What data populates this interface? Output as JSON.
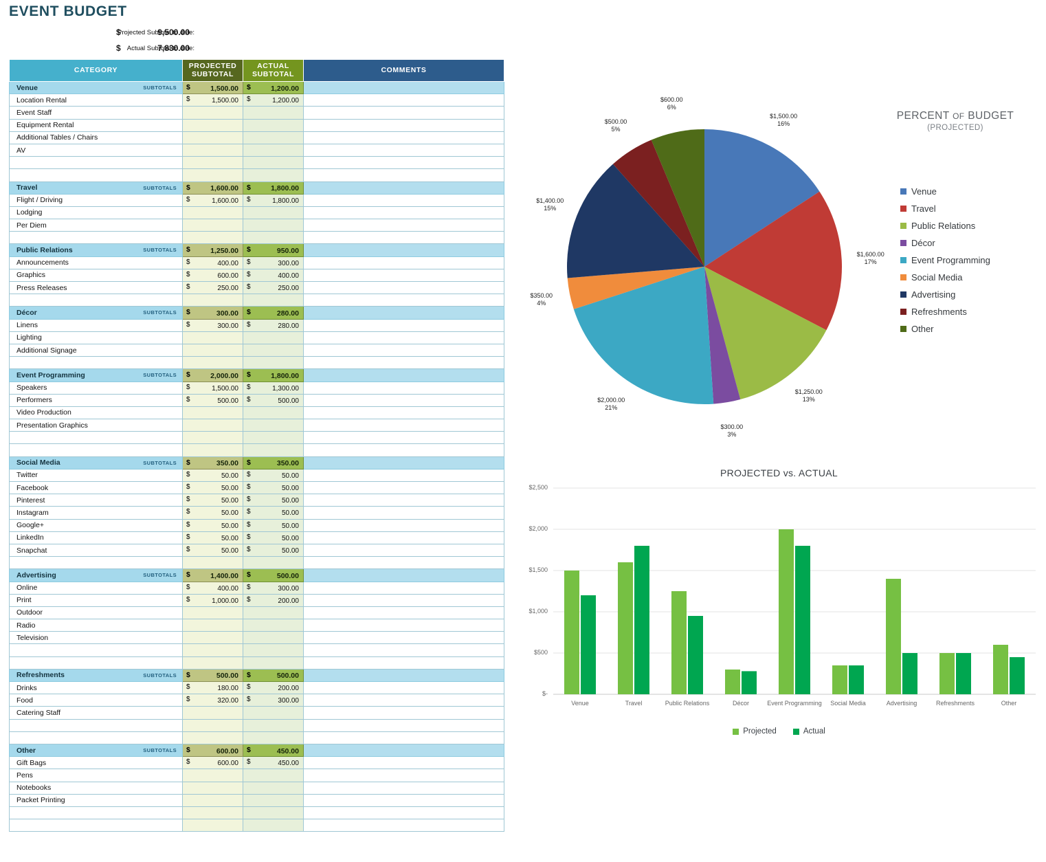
{
  "title": "EVENT BUDGET",
  "summary": {
    "projected_label": "Projected Subtotal to date:",
    "projected_currency": "$",
    "projected_value": "9,500.00",
    "actual_label": "Actual Subtotal to date:",
    "actual_currency": "$",
    "actual_value": "7,830.00"
  },
  "table": {
    "headers": {
      "category": "CATEGORY",
      "projected": "PROJECTED SUBTOTAL",
      "projected_l1": "PROJECTED",
      "projected_l2": "SUBTOTAL",
      "actual_l1": "ACTUAL",
      "actual_l2": "SUBTOTAL",
      "comments": "COMMENTS"
    },
    "subtotals_word": "SUBTOTALS",
    "currency": "$",
    "sections": [
      {
        "name": "Venue",
        "projected": "1,500.00",
        "actual": "1,200.00",
        "comment": "",
        "items": [
          {
            "name": "Location Rental",
            "projected": "1,500.00",
            "actual": "1,200.00",
            "comment": ""
          },
          {
            "name": "Event Staff",
            "projected": "",
            "actual": "",
            "comment": ""
          },
          {
            "name": "Equipment Rental",
            "projected": "",
            "actual": "",
            "comment": ""
          },
          {
            "name": "Additional Tables / Chairs",
            "projected": "",
            "actual": "",
            "comment": ""
          },
          {
            "name": "AV",
            "projected": "",
            "actual": "",
            "comment": ""
          },
          {
            "name": "",
            "projected": "",
            "actual": "",
            "comment": ""
          },
          {
            "name": "",
            "projected": "",
            "actual": "",
            "comment": ""
          }
        ]
      },
      {
        "name": "Travel",
        "projected": "1,600.00",
        "actual": "1,800.00",
        "comment": "",
        "items": [
          {
            "name": "Flight / Driving",
            "projected": "1,600.00",
            "actual": "1,800.00",
            "comment": ""
          },
          {
            "name": "Lodging",
            "projected": "",
            "actual": "",
            "comment": ""
          },
          {
            "name": "Per Diem",
            "projected": "",
            "actual": "",
            "comment": ""
          },
          {
            "name": "",
            "projected": "",
            "actual": "",
            "comment": ""
          }
        ]
      },
      {
        "name": "Public Relations",
        "projected": "1,250.00",
        "actual": "950.00",
        "comment": "",
        "items": [
          {
            "name": "Announcements",
            "projected": "400.00",
            "actual": "300.00",
            "comment": ""
          },
          {
            "name": "Graphics",
            "projected": "600.00",
            "actual": "400.00",
            "comment": ""
          },
          {
            "name": "Press Releases",
            "projected": "250.00",
            "actual": "250.00",
            "comment": ""
          },
          {
            "name": "",
            "projected": "",
            "actual": "",
            "comment": ""
          }
        ]
      },
      {
        "name": "Décor",
        "projected": "300.00",
        "actual": "280.00",
        "comment": "",
        "items": [
          {
            "name": "Linens",
            "projected": "300.00",
            "actual": "280.00",
            "comment": ""
          },
          {
            "name": "Lighting",
            "projected": "",
            "actual": "",
            "comment": ""
          },
          {
            "name": "Additional Signage",
            "projected": "",
            "actual": "",
            "comment": ""
          },
          {
            "name": "",
            "projected": "",
            "actual": "",
            "comment": ""
          }
        ]
      },
      {
        "name": "Event Programming",
        "projected": "2,000.00",
        "actual": "1,800.00",
        "comment": "",
        "items": [
          {
            "name": "Speakers",
            "projected": "1,500.00",
            "actual": "1,300.00",
            "comment": ""
          },
          {
            "name": "Performers",
            "projected": "500.00",
            "actual": "500.00",
            "comment": ""
          },
          {
            "name": "Video Production",
            "projected": "",
            "actual": "",
            "comment": ""
          },
          {
            "name": "Presentation Graphics",
            "projected": "",
            "actual": "",
            "comment": ""
          },
          {
            "name": "",
            "projected": "",
            "actual": "",
            "comment": ""
          },
          {
            "name": "",
            "projected": "",
            "actual": "",
            "comment": ""
          }
        ]
      },
      {
        "name": "Social Media",
        "projected": "350.00",
        "actual": "350.00",
        "comment": "",
        "items": [
          {
            "name": "Twitter",
            "projected": "50.00",
            "actual": "50.00",
            "comment": ""
          },
          {
            "name": "Facebook",
            "projected": "50.00",
            "actual": "50.00",
            "comment": ""
          },
          {
            "name": "Pinterest",
            "projected": "50.00",
            "actual": "50.00",
            "comment": ""
          },
          {
            "name": "Instagram",
            "projected": "50.00",
            "actual": "50.00",
            "comment": ""
          },
          {
            "name": "Google+",
            "projected": "50.00",
            "actual": "50.00",
            "comment": ""
          },
          {
            "name": "LinkedIn",
            "projected": "50.00",
            "actual": "50.00",
            "comment": ""
          },
          {
            "name": "Snapchat",
            "projected": "50.00",
            "actual": "50.00",
            "comment": ""
          },
          {
            "name": "",
            "projected": "",
            "actual": "",
            "comment": ""
          }
        ]
      },
      {
        "name": "Advertising",
        "projected": "1,400.00",
        "actual": "500.00",
        "comment": "",
        "items": [
          {
            "name": "Online",
            "projected": "400.00",
            "actual": "300.00",
            "comment": ""
          },
          {
            "name": "Print",
            "projected": "1,000.00",
            "actual": "200.00",
            "comment": ""
          },
          {
            "name": "Outdoor",
            "projected": "",
            "actual": "",
            "comment": ""
          },
          {
            "name": "Radio",
            "projected": "",
            "actual": "",
            "comment": ""
          },
          {
            "name": "Television",
            "projected": "",
            "actual": "",
            "comment": ""
          },
          {
            "name": "",
            "projected": "",
            "actual": "",
            "comment": ""
          },
          {
            "name": "",
            "projected": "",
            "actual": "",
            "comment": ""
          }
        ]
      },
      {
        "name": "Refreshments",
        "projected": "500.00",
        "actual": "500.00",
        "comment": "",
        "items": [
          {
            "name": "Drinks",
            "projected": "180.00",
            "actual": "200.00",
            "comment": ""
          },
          {
            "name": "Food",
            "projected": "320.00",
            "actual": "300.00",
            "comment": ""
          },
          {
            "name": "Catering Staff",
            "projected": "",
            "actual": "",
            "comment": ""
          },
          {
            "name": "",
            "projected": "",
            "actual": "",
            "comment": ""
          },
          {
            "name": "",
            "projected": "",
            "actual": "",
            "comment": ""
          }
        ]
      },
      {
        "name": "Other",
        "projected": "600.00",
        "actual": "450.00",
        "comment": "",
        "items": [
          {
            "name": "Gift Bags",
            "projected": "600.00",
            "actual": "450.00",
            "comment": ""
          },
          {
            "name": "Pens",
            "projected": "",
            "actual": "",
            "comment": ""
          },
          {
            "name": "Notebooks",
            "projected": "",
            "actual": "",
            "comment": ""
          },
          {
            "name": "Packet Printing",
            "projected": "",
            "actual": "",
            "comment": ""
          },
          {
            "name": "",
            "projected": "",
            "actual": "",
            "comment": ""
          },
          {
            "name": "",
            "projected": "",
            "actual": "",
            "comment": ""
          }
        ]
      }
    ]
  },
  "chart_data": [
    {
      "type": "pie",
      "title": "PERCENT OF BUDGET",
      "title_part1": "PERCENT",
      "title_of": "OF",
      "title_part2": "BUDGET",
      "subtitle": "(PROJECTED)",
      "legend_position": "right",
      "categories": [
        "Venue",
        "Travel",
        "Public Relations",
        "Décor",
        "Event Programming",
        "Social Media",
        "Advertising",
        "Refreshments",
        "Other"
      ],
      "values": [
        1500,
        1600,
        1250,
        300,
        2000,
        350,
        1400,
        500,
        600
      ],
      "percents": [
        16,
        17,
        13,
        3,
        21,
        4,
        15,
        5,
        6
      ],
      "labels": [
        {
          "value": "$1,500.00",
          "percent": "16%"
        },
        {
          "value": "$1,600.00",
          "percent": "17%"
        },
        {
          "value": "$1,250.00",
          "percent": "13%"
        },
        {
          "value": "$300.00",
          "percent": "3%"
        },
        {
          "value": "$2,000.00",
          "percent": "21%"
        },
        {
          "value": "$350.00",
          "percent": "4%"
        },
        {
          "value": "$1,400.00",
          "percent": "15%"
        },
        {
          "value": "$500.00",
          "percent": "5%"
        },
        {
          "value": "$600.00",
          "percent": "6%"
        }
      ],
      "colors": [
        "#4878B8",
        "#C03B35",
        "#9BBB46",
        "#7B4CA0",
        "#3CA8C4",
        "#F08C3C",
        "#1F3864",
        "#7B2020",
        "#4F6B18"
      ]
    },
    {
      "type": "bar",
      "title": "PROJECTED vs. ACTUAL",
      "categories": [
        "Venue",
        "Travel",
        "Public Relations",
        "Décor",
        "Event Programming",
        "Social Media",
        "Advertising",
        "Refreshments",
        "Other"
      ],
      "series": [
        {
          "name": "Projected",
          "values": [
            1500,
            1600,
            1250,
            300,
            2000,
            350,
            1400,
            500,
            600
          ],
          "color": "#76C043"
        },
        {
          "name": "Actual",
          "values": [
            1200,
            1800,
            950,
            280,
            1800,
            350,
            500,
            500,
            450
          ],
          "color": "#00A650"
        }
      ],
      "ylim": [
        0,
        2500
      ],
      "yticks": [
        0,
        500,
        1000,
        1500,
        2000,
        2500
      ],
      "ytick_labels": [
        "$-",
        "$500",
        "$1,000",
        "$1,500",
        "$2,000",
        "$2,500"
      ],
      "xlabel": "",
      "ylabel": "",
      "grid": true,
      "legend_position": "bottom"
    }
  ]
}
